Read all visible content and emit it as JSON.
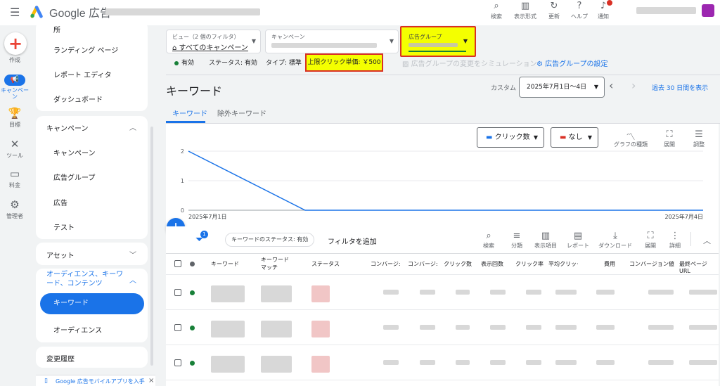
{
  "header": {
    "product": "Google 広告",
    "actions": [
      {
        "label": "検索",
        "icon": "search-icon",
        "glyph": "⌕"
      },
      {
        "label": "表示形式",
        "icon": "display-format-icon",
        "glyph": "▥"
      },
      {
        "label": "更新",
        "icon": "refresh-icon",
        "glyph": "↻"
      },
      {
        "label": "ヘルプ",
        "icon": "help-icon",
        "glyph": "?"
      },
      {
        "label": "通知",
        "icon": "bell-icon",
        "glyph": "♪"
      }
    ]
  },
  "rail": {
    "create": "作成",
    "campaigns": "キャンペーン",
    "goals": "目標",
    "tools": "ツール",
    "billing": "料金",
    "admin": "管理者"
  },
  "sidebar": {
    "top_items": [
      "所",
      "ランディング ページ",
      "レポート エディタ",
      "ダッシュボード"
    ],
    "campaign_section": {
      "title": "キャンペーン",
      "items": [
        "キャンペーン",
        "広告グループ",
        "広告",
        "テスト"
      ]
    },
    "assets": "アセット",
    "audience_section": {
      "title": "オーディエンス、キーワード、コンテンツ",
      "active": "キーワード",
      "items": [
        "オーディエンス"
      ]
    },
    "history": "変更履歴",
    "app_banner": "Google 広告モバイルアプリを入手",
    "close_glyph": "×"
  },
  "filters": {
    "view": {
      "label": "ビュー（2 個のフィルタ）",
      "value": "すべてのキャンペーン"
    },
    "campaign": {
      "label": "キャンペーン"
    },
    "adgroup": {
      "label": "広告グループ"
    }
  },
  "status_bar": {
    "enabled": "有効",
    "status": "ステータス: 有効",
    "type": "タイプ: 標準",
    "max_cpc": "上限クリック単価: ￥500",
    "simulate": "広告グループの変更をシミュレーション",
    "settings": "広告グループの設定"
  },
  "page": {
    "title": "キーワード",
    "range_label": "カスタム",
    "date_range": "2025年7月1日～4日",
    "last30": "過去 30 日間を表示"
  },
  "tabs": {
    "keywords": "キーワード",
    "negative": "除外キーワード"
  },
  "chart_controls": {
    "metric1": "クリック数",
    "metric2": "なし",
    "tools": [
      {
        "label": "グラフの種類",
        "icon": "chart-type-icon",
        "glyph": "〽"
      },
      {
        "label": "展開",
        "icon": "expand-icon",
        "glyph": "⛶"
      },
      {
        "label": "調整",
        "icon": "adjust-icon",
        "glyph": "☰"
      }
    ]
  },
  "chart_data": {
    "type": "line",
    "x": [
      "2025年7月1日",
      "2025年7月2日",
      "2025年7月3日",
      "2025年7月4日"
    ],
    "series": [
      {
        "values": [
          2,
          0,
          0,
          0
        ]
      }
    ],
    "x_tick_labels": [
      "2025年7月1日",
      "2025年7月4日"
    ],
    "y_ticks": [
      "0",
      "1",
      "2"
    ],
    "ylim": [
      0,
      2
    ],
    "grid": true,
    "color": "#1a73e8"
  },
  "table_toolbar": {
    "status_chip": "キーワードのステータス: 有効",
    "add_filter": "フィルタを追加",
    "filter_count": "1",
    "tools": [
      {
        "label": "検索",
        "icon": "search-icon",
        "glyph": "⌕"
      },
      {
        "label": "分類",
        "icon": "segment-icon",
        "glyph": "≡"
      },
      {
        "label": "表示項目",
        "icon": "columns-icon",
        "glyph": "▥"
      },
      {
        "label": "レポート",
        "icon": "report-icon",
        "glyph": "▤"
      },
      {
        "label": "ダウンロード",
        "icon": "download-icon",
        "glyph": "⤓"
      },
      {
        "label": "展開",
        "icon": "expand-icon",
        "glyph": "⛶"
      },
      {
        "label": "詳細",
        "icon": "more-icon",
        "glyph": "⋮"
      }
    ]
  },
  "table": {
    "columns": [
      "キーワード",
      "キーワード\nマッチ",
      "ステータス",
      "コンバージ:",
      "コンバージ:",
      "クリック数",
      "表示回数",
      "クリック率",
      "平均クリッ·",
      "費用",
      "コンバージョン値",
      "最終ページ URL"
    ],
    "row_count": 3
  }
}
